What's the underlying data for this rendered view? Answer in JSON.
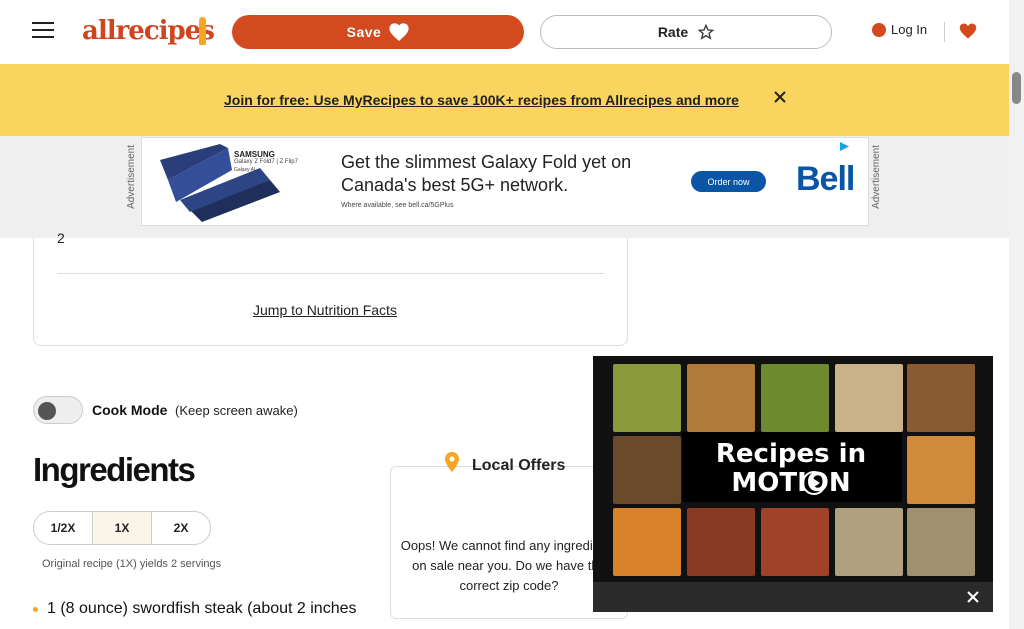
{
  "header": {
    "logo_text": "allrecipes",
    "save_label": "Save",
    "rate_label": "Rate",
    "login_label": "Log In"
  },
  "banner": {
    "text": "Join for free: Use MyRecipes to save 100K+ recipes from Allrecipes and more"
  },
  "ad": {
    "side_label": "Advertisement",
    "brand": "SAMSUNG",
    "model": "Galaxy Z Fold7 | Z Flip7",
    "ai_tag": "Galaxy AI",
    "headline": "Get the slimmest Galaxy Fold yet on Canada's best 5G+ network.",
    "fine_print": "Where available, see bell.ca/5GPlus",
    "cta": "Order now",
    "advertiser": "Bell"
  },
  "nutrition": {
    "servings_value": "2",
    "link_text": "Jump to Nutrition Facts"
  },
  "cook_mode": {
    "label": "Cook Mode",
    "sublabel": "(Keep screen awake)",
    "enabled": false
  },
  "ingredients": {
    "title": "Ingredients",
    "scale_options": [
      "1/2X",
      "1X",
      "2X"
    ],
    "selected_scale": "1X",
    "yield_note": "Original recipe (1X) yields 2 servings",
    "items": [
      "1 (8 ounce) swordfish steak (about 2 inches"
    ]
  },
  "local_offers": {
    "title": "Local Offers",
    "message": "Oops! We cannot find any ingredients on sale near you. Do we have the correct zip code?"
  },
  "video": {
    "title_line1": "Recipes in",
    "title_line2": "MOTION"
  },
  "colors": {
    "brand": "#d24a1e",
    "banner_bg": "#f9d55f",
    "accent_orange": "#f5a623"
  },
  "icons": [
    "hamburger-icon",
    "heart-icon",
    "star-icon",
    "user-icon",
    "close-icon",
    "location-pin-icon",
    "play-icon"
  ]
}
